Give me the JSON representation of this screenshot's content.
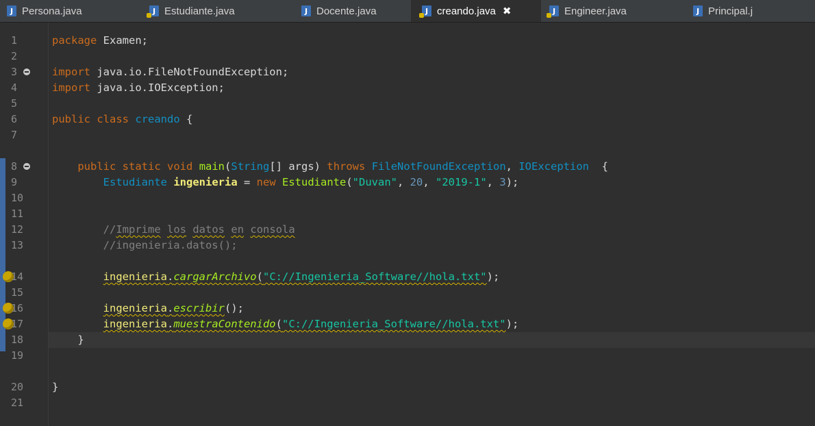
{
  "tabs": [
    {
      "label": "Persona.java",
      "active": false,
      "warning": false
    },
    {
      "label": "Estudiante.java",
      "active": false,
      "warning": true
    },
    {
      "label": "Docente.java",
      "active": false,
      "warning": false
    },
    {
      "label": "creando.java",
      "active": true,
      "warning": true,
      "close": "✖"
    },
    {
      "label": "Engineer.java",
      "active": false,
      "warning": true
    },
    {
      "label": "Principal.j",
      "active": false,
      "warning": false
    }
  ],
  "line_numbers": [
    "1",
    "2",
    "3",
    "4",
    "5",
    "6",
    "7",
    "8",
    "9",
    "10",
    "11",
    "12",
    "13",
    "14",
    "15",
    "16",
    "17",
    "18",
    "19",
    "20",
    "21"
  ],
  "code": {
    "l1": {
      "a": "package",
      "b": " Examen;"
    },
    "l3": {
      "a": "import",
      "b": " java.io.FileNotFoundException;"
    },
    "l4": {
      "a": "import",
      "b": " java.io.IOException;"
    },
    "l6": {
      "a": "public",
      "b": " ",
      "c": "class",
      "d": " ",
      "e": "creando",
      "f": " {"
    },
    "l8": {
      "a": "    public",
      "b": " ",
      "c": "static",
      "d": " ",
      "e": "void",
      "f": " ",
      "g": "main",
      "h": "(",
      "i": "String",
      "j": "[] args) ",
      "k": "throws",
      "l": " ",
      "m": "FileNotFoundException",
      "n": ", ",
      "o": "IOException",
      "p": "  {"
    },
    "l9": {
      "a": "        ",
      "b": "Estudiante",
      "c": " ",
      "d": "ingenieria",
      "e": " = ",
      "f": "new",
      "g": " ",
      "h": "Estudiante",
      "i": "(",
      "j": "\"Duvan\"",
      "k": ", ",
      "l": "20",
      "m": ", ",
      "n": "\"2019-1\"",
      "o": ", ",
      "p": "3",
      "q": ");"
    },
    "l11": {
      "a": "        ",
      "b": "//",
      "c": "Imprime",
      "d": " ",
      "e": "los",
      "f": " ",
      "g": "datos",
      "h": " ",
      "i": "en",
      "j": " ",
      "k": "consola"
    },
    "l12": {
      "a": "        ",
      "b": "//ingenieria.datos();"
    },
    "l14": {
      "a": "        ",
      "b": "ingenieria",
      "c": ".",
      "d": "cargarArchivo",
      "e": "(",
      "f": "\"C://Ingenieria_Software//hola.txt\"",
      "g": ");"
    },
    "l16": {
      "a": "        ",
      "b": "ingenieria",
      "c": ".",
      "d": "escribir",
      "e": "();"
    },
    "l17": {
      "a": "        ",
      "b": "ingenieria",
      "c": ".",
      "d": "muestraContenido",
      "e": "(",
      "f": "\"C://Ingenieria_Software//hola.txt\"",
      "g": ");"
    },
    "l18": {
      "a": "    }"
    },
    "l20": {
      "a": "}"
    }
  },
  "colors": {
    "keyword": "#cc6c1d",
    "type": "#1290c3",
    "method": "#a7ec21",
    "string": "#17c6a3",
    "comment": "#808080",
    "variable": "#f3ec79",
    "warning": "#d7b600"
  },
  "icons": {
    "java_file": "J",
    "fold": "fold-collapse-icon",
    "warning": "lightbulb-warning-icon"
  }
}
